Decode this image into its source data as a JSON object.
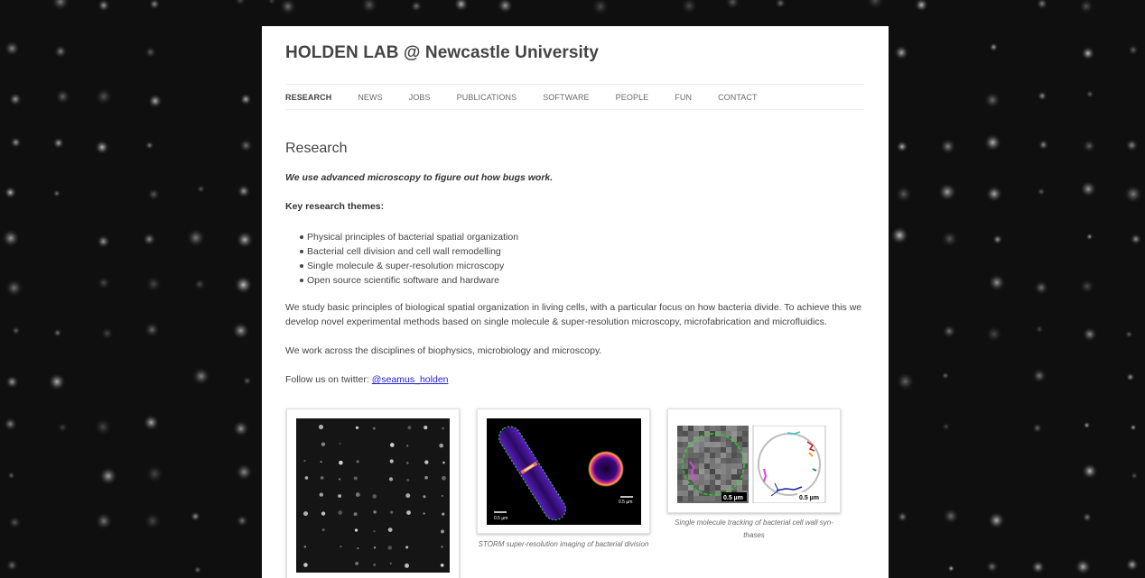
{
  "site": {
    "title": "HOLDEN LAB @ Newcastle University"
  },
  "nav": {
    "items": [
      {
        "label": "RESEARCH",
        "active": true
      },
      {
        "label": "NEWS",
        "active": false
      },
      {
        "label": "JOBS",
        "active": false
      },
      {
        "label": "PUBLICATIONS",
        "active": false
      },
      {
        "label": "SOFTWARE",
        "active": false
      },
      {
        "label": "PEOPLE",
        "active": false
      },
      {
        "label": "FUN",
        "active": false
      },
      {
        "label": "CONTACT",
        "active": false
      }
    ]
  },
  "page": {
    "title": "Research",
    "tagline": "We use advanced microscopy to figure out how bugs work.",
    "themes_heading": "Key research themes:",
    "themes": [
      "Physical principles of bacterial spatial organization",
      "Bacterial cell division and cell wall remodelling",
      "Single molecule & super-resolution microscopy",
      "Open source scientific software and hardware"
    ],
    "paragraph1": "We study basic principles of biological spatial organization in living cells, with a particular focus on how bacteria divide. To achieve this we develop novel experimental methods based on single molecule & super-resolution microscopy, microfabrication and microfluidics.",
    "paragraph2": "We work across the disciplines of biophysics, microbiology and microscopy.",
    "twitter_prefix": "Follow us on twitter: ",
    "twitter_handle": "@seamus_holden"
  },
  "figures": [
    {
      "caption": ""
    },
    {
      "caption": "STORM super-resolution imaging of bacterial division",
      "scale_left": "0.5 µm",
      "scale_right": "0.5 µm"
    },
    {
      "caption": "Single molecule tracking of bacterial cell wall syn-thases",
      "scale_left": "0.5 µm",
      "scale_right": "0.5 µm"
    }
  ],
  "colors": {
    "background": "#0f0f0f",
    "content_background": "#ffffff",
    "text": "#444444",
    "link": "#1f1fd6"
  }
}
